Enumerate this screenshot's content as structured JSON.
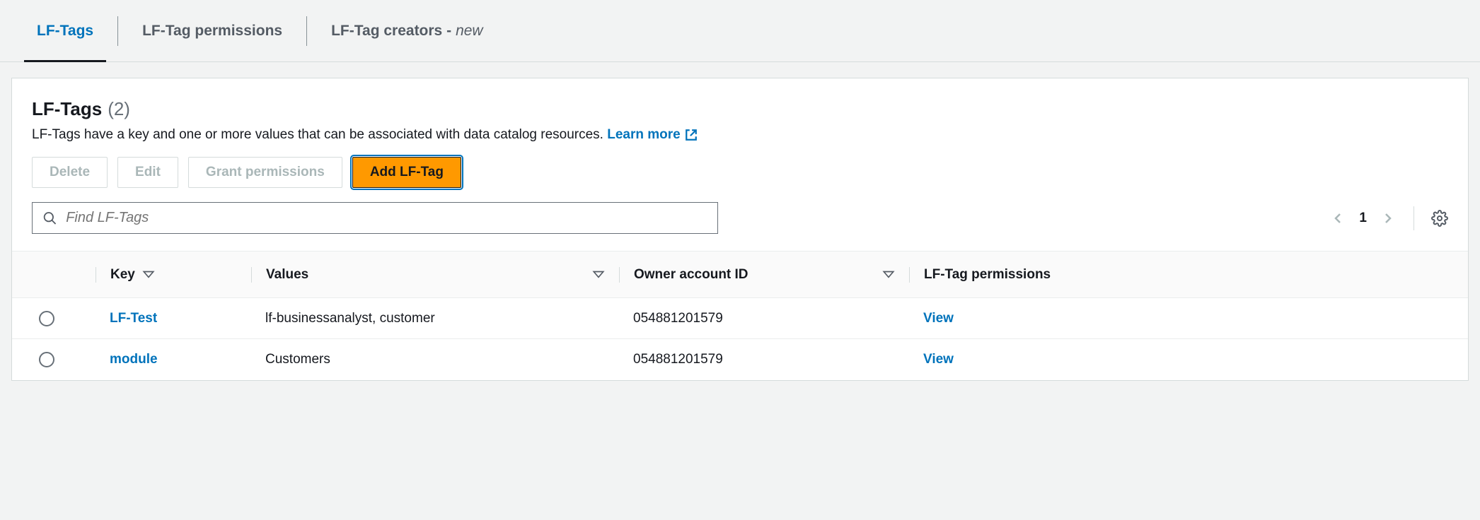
{
  "tabs": [
    {
      "label": "LF-Tags",
      "active": true
    },
    {
      "label": "LF-Tag permissions",
      "active": false
    },
    {
      "label": "LF-Tag creators - ",
      "active": false,
      "badge": "new"
    }
  ],
  "panel": {
    "title": "LF-Tags",
    "count": "(2)",
    "description": "LF-Tags have a key and one or more values that can be associated with data catalog resources.",
    "learn_more": "Learn more"
  },
  "actions": {
    "delete": "Delete",
    "edit": "Edit",
    "grant": "Grant permissions",
    "add": "Add LF-Tag"
  },
  "search": {
    "placeholder": "Find LF-Tags"
  },
  "pagination": {
    "page": "1"
  },
  "columns": {
    "key": "Key",
    "values": "Values",
    "owner": "Owner account ID",
    "permissions": "LF-Tag permissions"
  },
  "rows": [
    {
      "key": "LF-Test",
      "values": "lf-businessanalyst, customer",
      "owner": "054881201579",
      "perm": "View"
    },
    {
      "key": "module",
      "values": "Customers",
      "owner": "054881201579",
      "perm": "View"
    }
  ]
}
